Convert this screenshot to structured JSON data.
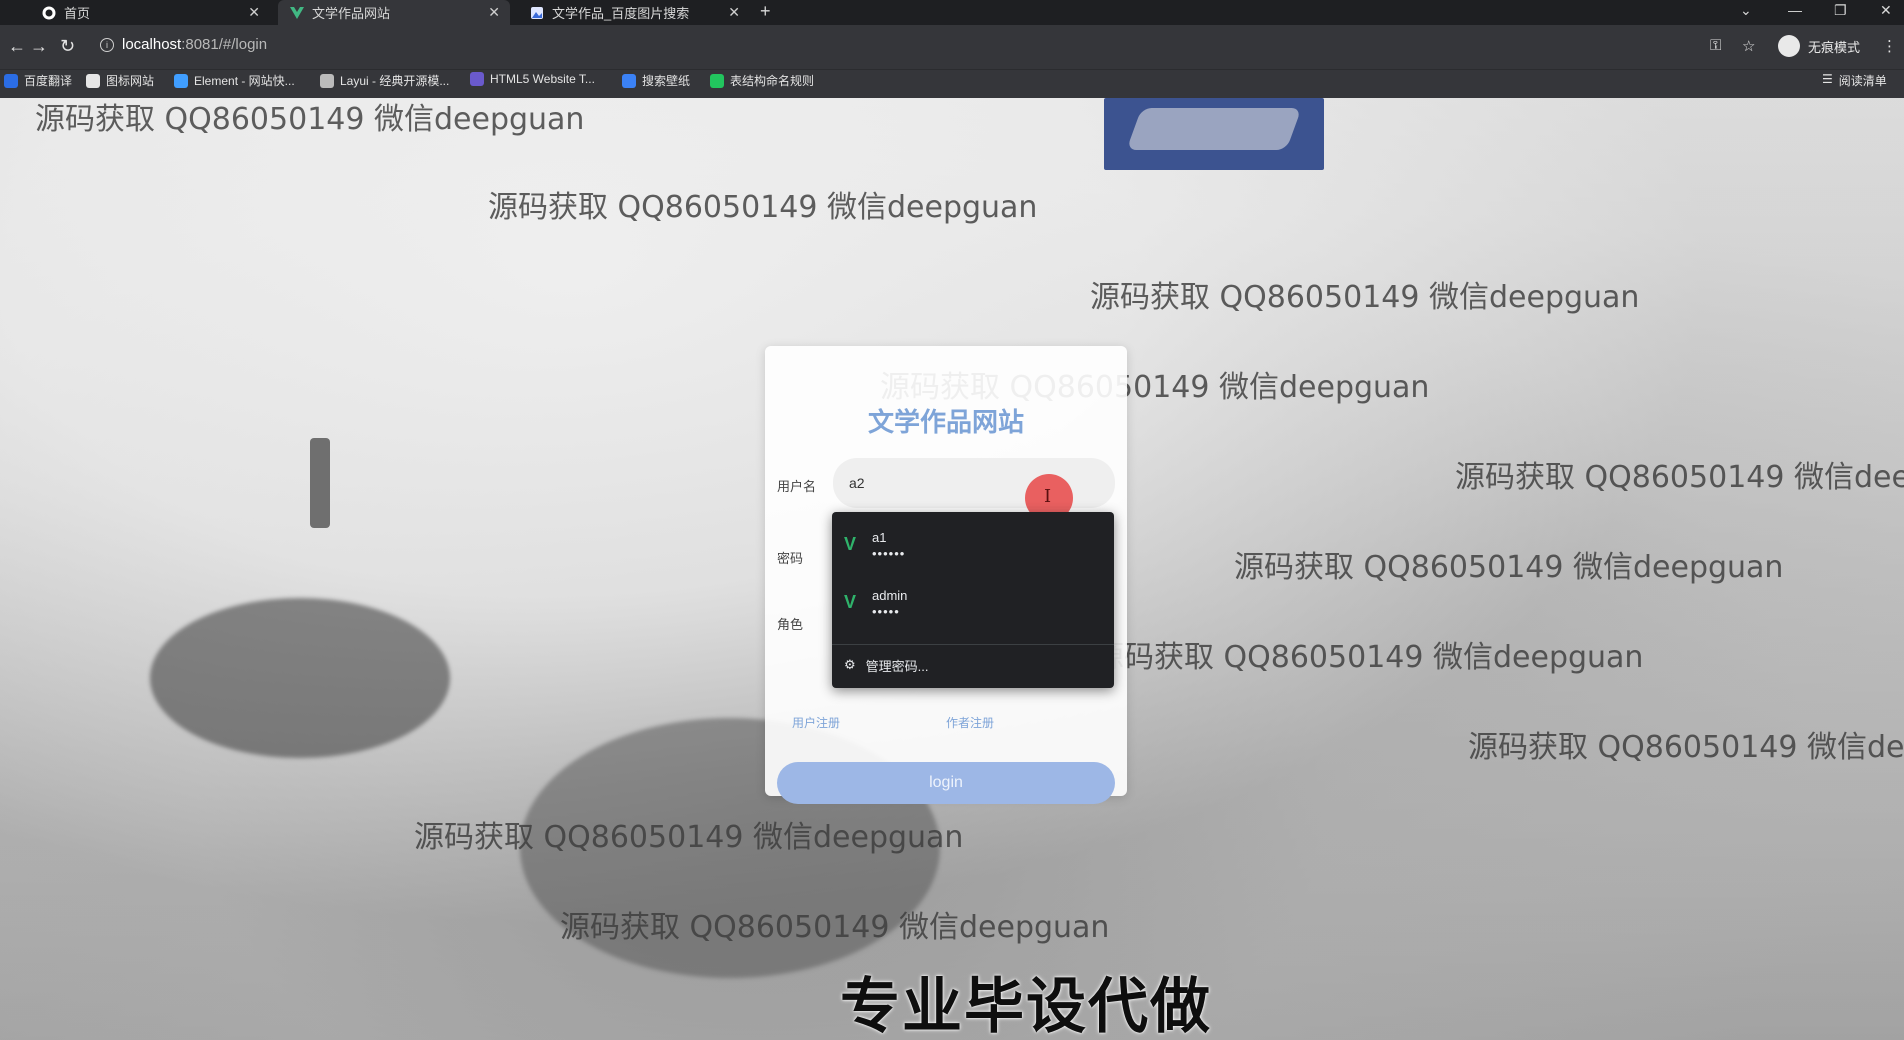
{
  "browser": {
    "tabs": [
      {
        "title": "首页",
        "icon": "github-icon"
      },
      {
        "title": "文学作品网站",
        "icon": "vue-icon"
      },
      {
        "title": "文学作品_百度图片搜索",
        "icon": "baidu-image-icon"
      }
    ],
    "address": {
      "host": "localhost",
      "path": ":8081/#/login"
    },
    "profile_label": "无痕模式",
    "bookmarks": [
      {
        "label": "百度翻译",
        "color": "#2b6de5"
      },
      {
        "label": "图标网站",
        "color": "#e6e6e6"
      },
      {
        "label": "Element - 网站快...",
        "color": "#409eff"
      },
      {
        "label": "Layui - 经典开源模...",
        "color": "#bbbbbb"
      },
      {
        "label": "HTML5 Website T...",
        "color": "#6a5acd"
      },
      {
        "label": "搜索壁纸",
        "color": "#3b82f6"
      },
      {
        "label": "表结构命名规则",
        "color": "#22c55e"
      }
    ],
    "reading_list_label": "阅读清单"
  },
  "watermark_text": "源码获取 QQ86050149 微信deepguan",
  "caption": "专业毕设代做",
  "login": {
    "site_title": "文学作品网站",
    "username_label": "用户名",
    "username_value": "a2",
    "password_label": "密码",
    "role_label": "角色",
    "login_button": "login",
    "user_register": "用户注册",
    "author_register": "作者注册"
  },
  "autofill": {
    "items": [
      {
        "username": "a1",
        "password_mask": "••••••"
      },
      {
        "username": "admin",
        "password_mask": "•••••"
      }
    ],
    "manage_label": "管理密码..."
  },
  "colors": {
    "accent": "#7ea4d8",
    "login_button": "#9db7e6",
    "key_icon": "#2fb36b",
    "logo_banner": "#3c5390"
  }
}
